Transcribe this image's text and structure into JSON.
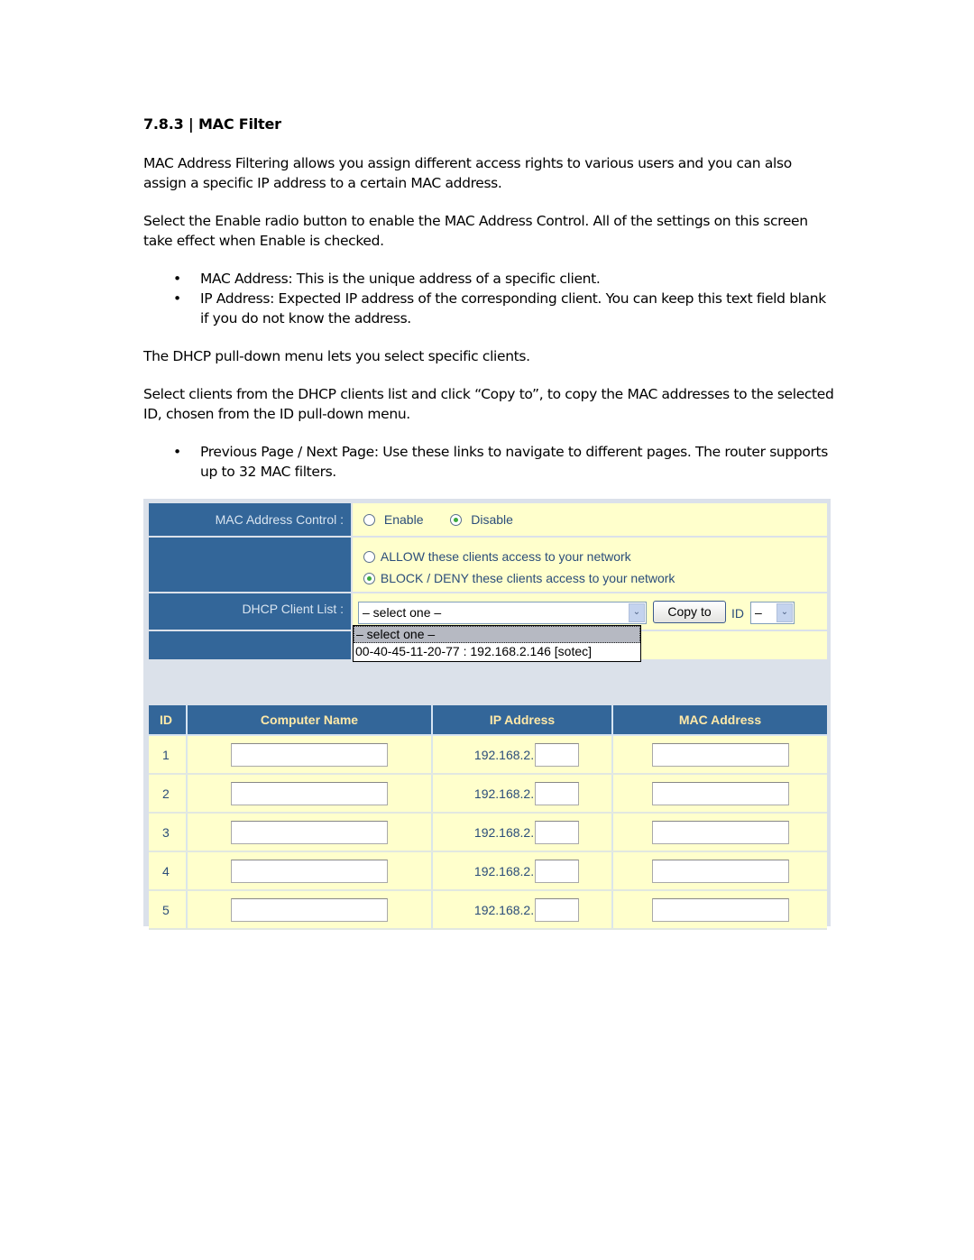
{
  "document": {
    "heading": "7.8.3 | MAC Filter",
    "paragraphs": [
      "MAC Address Filtering allows you assign different access rights to various users and you can also assign a specific IP address to a certain MAC address.",
      "Select the Enable radio button to enable the MAC Address Control. All of the settings on this screen take effect when Enable is checked.",
      "The DHCP pull-down menu lets you select specific clients.",
      "Select clients from the DHCP clients list and click “Copy to”, to copy the MAC addresses to the selected ID, chosen from the ID pull-down menu."
    ],
    "bullets_1": [
      "MAC Address: This is the unique address of a specific client.",
      "IP Address: Expected IP address of the corresponding client. You can keep this text field blank if you do not know the address."
    ],
    "bullets_2": [
      "Previous Page / Next Page: Use these links to navigate to different pages. The router supports up to 32 MAC filters."
    ],
    "bullet_glyph": "•"
  },
  "screenshot": {
    "mac_control": {
      "label": "MAC Address Control :",
      "options": [
        {
          "label": "Enable",
          "selected": false
        },
        {
          "label": "Disable",
          "selected": true
        }
      ]
    },
    "policy": {
      "options": [
        {
          "label": "ALLOW these clients access to your network",
          "selected": false
        },
        {
          "label": "BLOCK / DENY these clients access to your network",
          "selected": true
        }
      ]
    },
    "dhcp": {
      "label": "DHCP Client List :",
      "selected": "– select one –",
      "options": [
        "– select one –",
        "00-40-45-11-20-77 : 192.168.2.146 [sotec]"
      ],
      "copy_button": "Copy to",
      "id_label": "ID",
      "id_selected": "–",
      "arrow_glyph": "⌄"
    },
    "table": {
      "headers": [
        "ID",
        "Computer Name",
        "IP Address",
        "MAC Address"
      ],
      "ip_prefix": "192.168.2.",
      "rows": [
        {
          "id": "1",
          "computer_name": "",
          "ip_suffix": "",
          "mac": ""
        },
        {
          "id": "2",
          "computer_name": "",
          "ip_suffix": "",
          "mac": ""
        },
        {
          "id": "3",
          "computer_name": "",
          "ip_suffix": "",
          "mac": ""
        },
        {
          "id": "4",
          "computer_name": "",
          "ip_suffix": "",
          "mac": ""
        },
        {
          "id": "5",
          "computer_name": "",
          "ip_suffix": "",
          "mac": ""
        }
      ]
    }
  }
}
